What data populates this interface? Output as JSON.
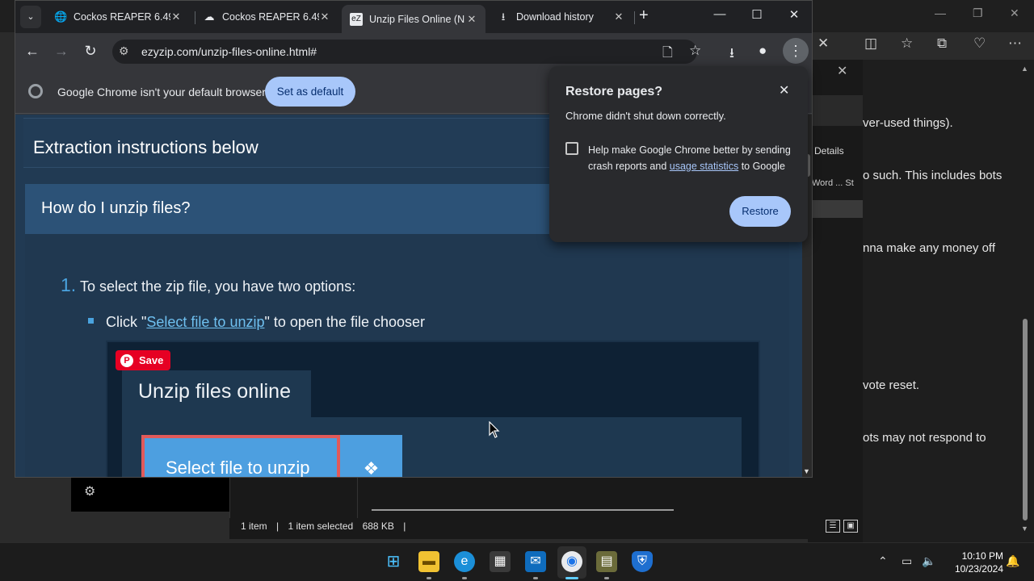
{
  "chrome": {
    "tabs": [
      {
        "title": "Cockos REAPER 6.49",
        "favicon": "🌐"
      },
      {
        "title": "Cockos REAPER 6.49",
        "favicon": "☁"
      },
      {
        "title": "Unzip Files Online (N",
        "favicon": "eZ"
      },
      {
        "title": "Download history",
        "favicon": "⭳"
      }
    ],
    "url": "ezyzip.com/unzip-files-online.html#",
    "infobar": {
      "text": "Google Chrome isn't your default browser",
      "button": "Set as default"
    }
  },
  "page": {
    "section_title": "Extraction instructions below",
    "faq_title": "How do I unzip files?",
    "step_number": "1.",
    "step_text": "To select the zip file, you have two options:",
    "bullet_prefix": "Click \"",
    "bullet_link": "Select file to unzip",
    "bullet_suffix": "\" to open the file chooser",
    "screenshot": {
      "pin_label": "Save",
      "tab_title": "Unzip files online",
      "button_label": "Select file to unzip"
    }
  },
  "restore_dialog": {
    "title": "Restore pages?",
    "message": "Chrome didn't shut down correctly.",
    "checkbox_prefix": "Help make Google Chrome better by sending crash reports and ",
    "checkbox_link": "usage statistics",
    "checkbox_suffix": " to Google",
    "restore_button": "Restore"
  },
  "background": {
    "article_lines": [
      "ver-used things).",
      "o such. This includes bots",
      "nna make any money off",
      "vote reset.",
      "ots may not respond to"
    ],
    "explorer_details": "Details",
    "explorer_columns": "Word ...   St",
    "explorer_status": {
      "items": "1 item",
      "selected": "1 item selected",
      "size": "688 KB"
    }
  },
  "taskbar": {
    "time": "10:10 PM",
    "date": "10/23/2024"
  }
}
